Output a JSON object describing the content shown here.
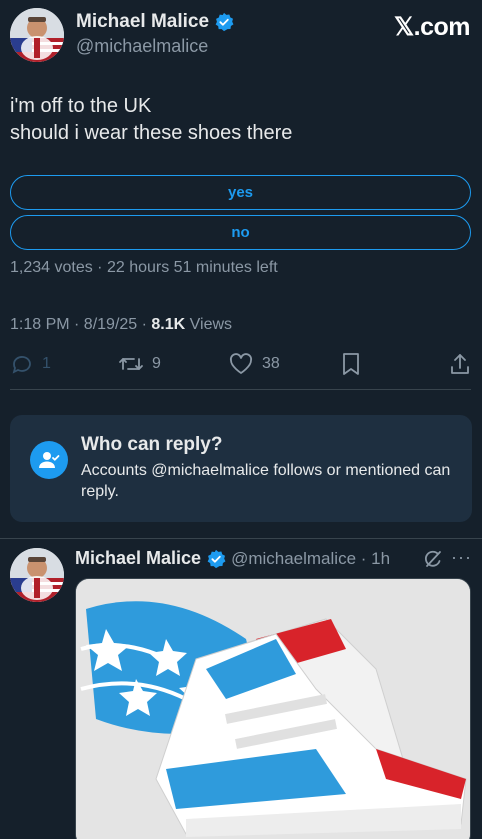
{
  "brand": {
    "text": "𝕏.com"
  },
  "author": {
    "display_name": "Michael Malice",
    "handle": "@michaelmalice"
  },
  "tweet": {
    "lines": [
      "i'm off to the UK",
      "should i wear these shoes there"
    ]
  },
  "poll": {
    "options": [
      "yes",
      "no"
    ],
    "meta": "1,234 votes · 22 hours 51 minutes left"
  },
  "timestamp": {
    "time_date": "1:18 PM · 8/19/25 · ",
    "views_count": "8.1K",
    "views_label": " Views"
  },
  "actions": {
    "replies": "1",
    "retweets": "9",
    "likes": "38"
  },
  "reply_restriction": {
    "title": "Who can reply?",
    "description": "Accounts @michaelmalice follows or mentioned can reply."
  },
  "reply_tweet": {
    "display_name": "Michael Malice",
    "handle_time": "@michaelmalice · 1h",
    "more": "···"
  },
  "colors": {
    "background": "#15202b",
    "accent": "#1d9bf0",
    "muted_text": "#8b98a5",
    "panel": "#1e2f40"
  },
  "icons": [
    "verified-badge-icon",
    "reply-icon",
    "retweet-icon",
    "like-icon",
    "bookmark-icon",
    "share-icon",
    "add-person-icon",
    "grok-icon",
    "more-icon"
  ]
}
